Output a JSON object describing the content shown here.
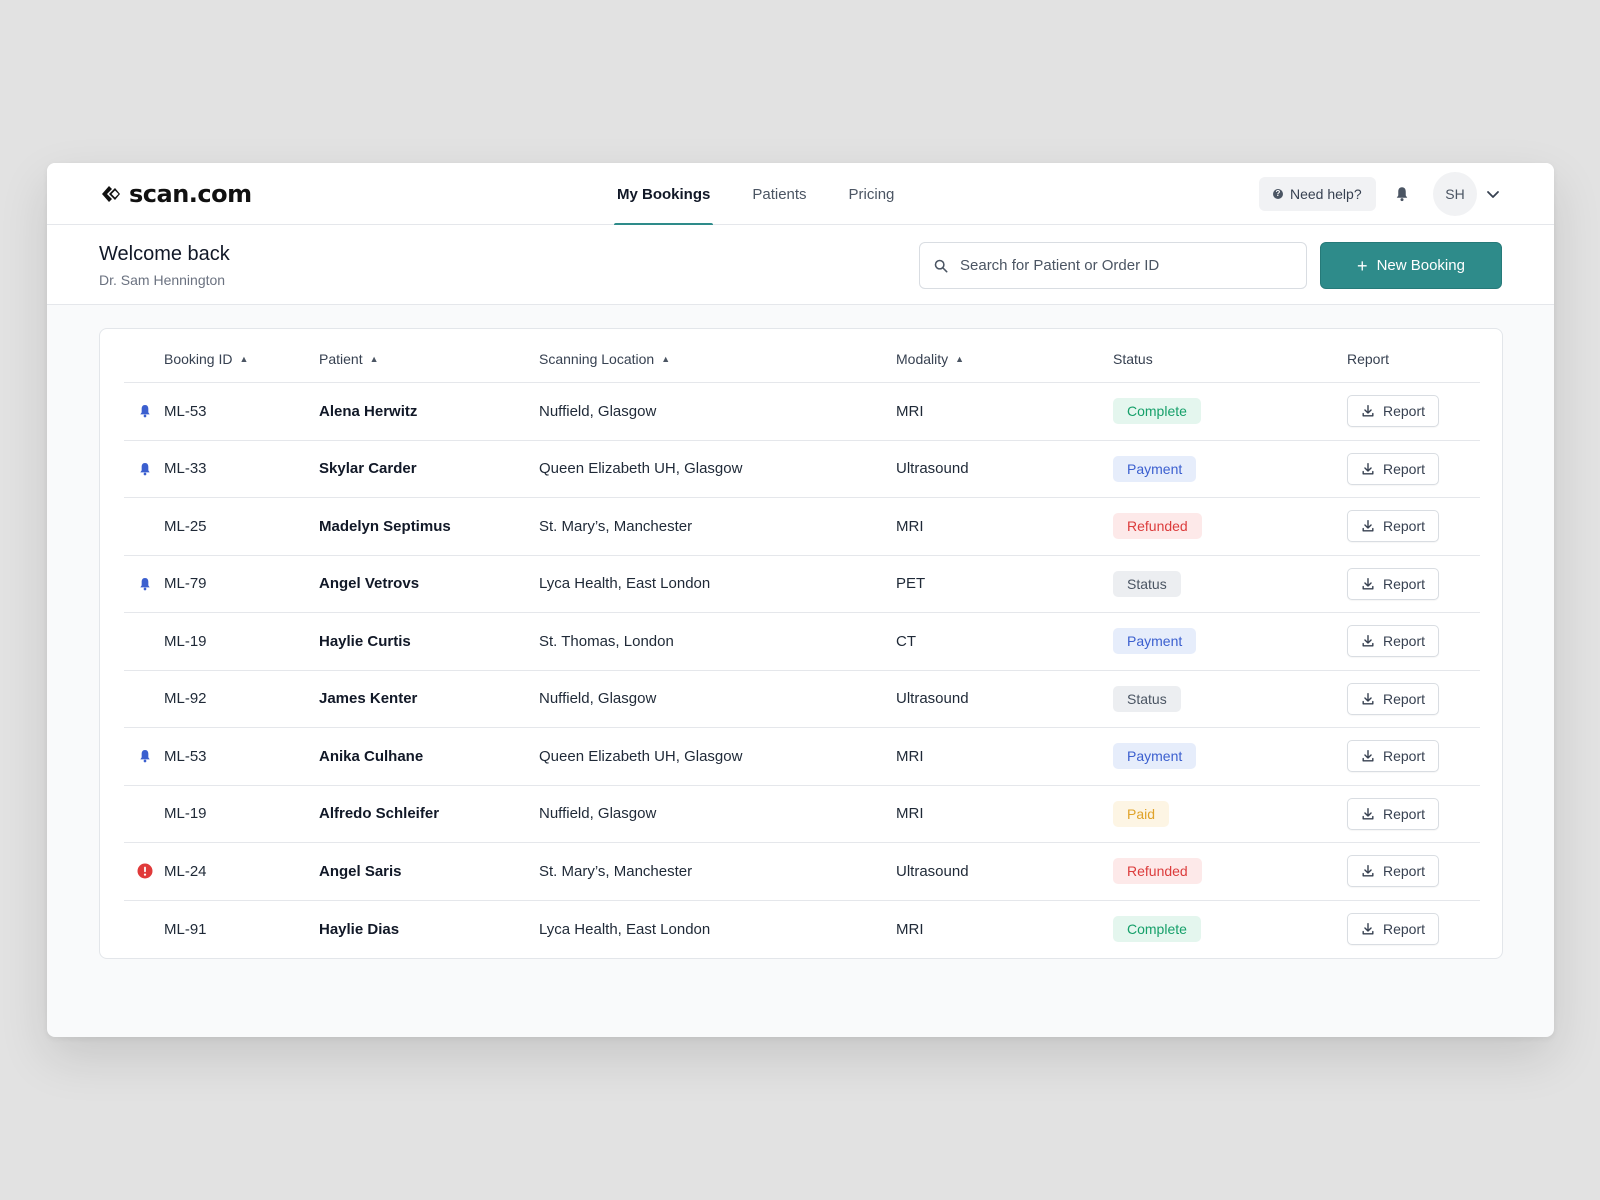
{
  "brand": {
    "name": "scan.com"
  },
  "nav": {
    "items": [
      {
        "label": "My Bookings",
        "active": true
      },
      {
        "label": "Patients",
        "active": false
      },
      {
        "label": "Pricing",
        "active": false
      }
    ],
    "help_label": "Need help?",
    "avatar_initials": "SH"
  },
  "header": {
    "title": "Welcome back",
    "subtitle": "Dr. Sam Hennington",
    "search_placeholder": "Search for Patient or Order ID",
    "new_booking_label": "New Booking"
  },
  "table": {
    "columns": [
      {
        "label": "Booking ID",
        "sortable": true
      },
      {
        "label": "Patient",
        "sortable": true
      },
      {
        "label": "Scanning Location",
        "sortable": true
      },
      {
        "label": "Modality",
        "sortable": true
      },
      {
        "label": "Status",
        "sortable": false
      },
      {
        "label": "Report",
        "sortable": false
      }
    ],
    "report_button_label": "Report",
    "rows": [
      {
        "icon": "bell-icon",
        "id": "ML-53",
        "patient": "Alena Herwitz",
        "location": "Nuffield, Glasgow",
        "modality": "MRI",
        "status": "Complete",
        "status_type": "complete"
      },
      {
        "icon": "bell-icon",
        "id": "ML-33",
        "patient": "Skylar Carder",
        "location": "Queen Elizabeth UH, Glasgow",
        "modality": "Ultrasound",
        "status": "Payment",
        "status_type": "payment"
      },
      {
        "icon": "",
        "id": "ML-25",
        "patient": "Madelyn Septimus",
        "location": "St. Mary’s, Manchester",
        "modality": "MRI",
        "status": "Refunded",
        "status_type": "refunded"
      },
      {
        "icon": "bell-icon",
        "id": "ML-79",
        "patient": "Angel Vetrovs",
        "location": "Lyca Health, East London",
        "modality": "PET",
        "status": "Status",
        "status_type": "status"
      },
      {
        "icon": "",
        "id": "ML-19",
        "patient": "Haylie Curtis",
        "location": "St. Thomas, London",
        "modality": "CT",
        "status": "Payment",
        "status_type": "payment"
      },
      {
        "icon": "",
        "id": "ML-92",
        "patient": "James Kenter",
        "location": "Nuffield, Glasgow",
        "modality": "Ultrasound",
        "status": "Status",
        "status_type": "status"
      },
      {
        "icon": "bell-icon",
        "id": "ML-53",
        "patient": "Anika Culhane",
        "location": "Queen Elizabeth UH, Glasgow",
        "modality": "MRI",
        "status": "Payment",
        "status_type": "payment"
      },
      {
        "icon": "",
        "id": "ML-19",
        "patient": "Alfredo Schleifer",
        "location": "Nuffield, Glasgow",
        "modality": "MRI",
        "status": "Paid",
        "status_type": "paid"
      },
      {
        "icon": "alert-icon",
        "id": "ML-24",
        "patient": "Angel Saris",
        "location": "St. Mary’s, Manchester",
        "modality": "Ultrasound",
        "status": "Refunded",
        "status_type": "refunded"
      },
      {
        "icon": "",
        "id": "ML-91",
        "patient": "Haylie Dias",
        "location": "Lyca Health, East London",
        "modality": "MRI",
        "status": "Complete",
        "status_type": "complete"
      }
    ]
  },
  "colors": {
    "accent": "#2e8b8a",
    "bell": "#3b5fcf",
    "alert": "#e03a3a"
  }
}
